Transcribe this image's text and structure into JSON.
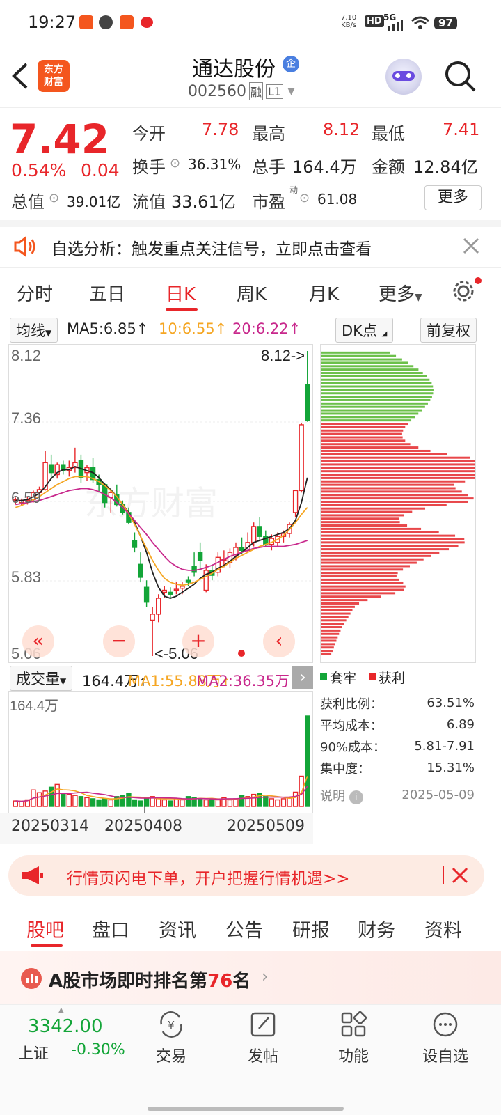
{
  "status_bar": {
    "time": "19:27",
    "net_speed": "7.10",
    "net_unit": "KB/s",
    "hd": "HD",
    "signal": "5G",
    "battery": "97"
  },
  "header": {
    "logo_line1": "东方",
    "logo_line2": "财富",
    "stock_name": "通达股份",
    "badge": "企",
    "code": "002560",
    "tag1": "融",
    "tag2": "L1"
  },
  "quote": {
    "price": "7.42",
    "change_pct": "0.54%",
    "change": "0.04",
    "open_label": "今开",
    "open": "7.78",
    "high_label": "最高",
    "high": "8.12",
    "low_label": "最低",
    "low": "7.41",
    "turnover_label": "换手",
    "turnover": "36.31%",
    "volume_label": "总手",
    "volume": "164.4万",
    "amount_label": "金额",
    "amount": "12.84亿",
    "mcap_label": "总值",
    "mcap": "39.01亿",
    "float_label": "流值",
    "float": "33.61亿",
    "pe_label": "市盈",
    "pe_sup": "动",
    "pe": "61.08",
    "more_btn": "更多"
  },
  "banner": {
    "text": "自选分析：触发重点关注信号，立即点击查看"
  },
  "kline_tabs": [
    "分时",
    "五日",
    "日K",
    "周K",
    "月K",
    "更多"
  ],
  "ma_bar": {
    "select": "均线",
    "ma5": "MA5:6.85",
    "ma10": "10:6.55",
    "ma20": "20:6.22",
    "dk": "DK点",
    "adjust": "前复权"
  },
  "chart_labels": {
    "y_top": "8.12",
    "y_2": "7.36",
    "y_3": "6.59",
    "y_4": "5.83",
    "y_bottom": "5.06",
    "max_marker": "8.12->",
    "min_marker": "<-5.06",
    "watermark": "东方财富"
  },
  "volume_bar": {
    "select": "成交量",
    "vol": "164.4万",
    "ma1": "MA1:55.88万",
    "ma2": "MA2:36.35万",
    "vol_top": "164.4万"
  },
  "dates": [
    "20250314",
    "20250408",
    "20250509"
  ],
  "chip": {
    "legend_hold": "套牢",
    "legend_profit": "获利",
    "rows": [
      {
        "label": "获利比例：",
        "value": "63.51%"
      },
      {
        "label": "平均成本：",
        "value": "6.89"
      },
      {
        "label": "90%成本：",
        "value": "5.81-7.91"
      },
      {
        "label": "集中度：",
        "value": "15.31%"
      }
    ],
    "note": "说明",
    "date": "2025-05-09"
  },
  "promo": {
    "text": "行情页闪电下单，开户把握行情机遇>>"
  },
  "bottom_tabs": [
    "股吧",
    "盘口",
    "资讯",
    "公告",
    "研报",
    "财务",
    "资料"
  ],
  "rank": {
    "prefix": "A股市场即时排名第",
    "num": "76",
    "suffix": "名"
  },
  "index": {
    "value": "3342.00",
    "name": "上证",
    "change": "-0.30%"
  },
  "bottom_nav": [
    "交易",
    "发帖",
    "功能",
    "设自选"
  ],
  "colors": {
    "up": "#e8262a",
    "down": "#13a538",
    "ma5": "#222222",
    "ma10": "#f5a623",
    "ma20": "#c8288c"
  },
  "chart_data": {
    "type": "candlestick",
    "ylim": [
      5.06,
      8.12
    ],
    "candles": [
      [
        6.62,
        6.65,
        6.58,
        6.63
      ],
      [
        6.6,
        6.64,
        6.57,
        6.62
      ],
      [
        6.62,
        6.66,
        6.58,
        6.63
      ],
      [
        6.63,
        6.72,
        6.6,
        6.7
      ],
      [
        6.7,
        6.76,
        6.66,
        6.73
      ],
      [
        6.73,
        7.12,
        6.72,
        7.0
      ],
      [
        6.98,
        7.08,
        6.85,
        6.9
      ],
      [
        6.88,
        7.0,
        6.84,
        6.98
      ],
      [
        6.98,
        7.02,
        6.88,
        6.92
      ],
      [
        6.92,
        7.02,
        6.86,
        6.95
      ],
      [
        6.95,
        7.15,
        6.9,
        7.0
      ],
      [
        7.02,
        7.08,
        6.8,
        6.85
      ],
      [
        6.9,
        6.98,
        6.82,
        6.95
      ],
      [
        6.95,
        7.05,
        6.8,
        6.83
      ],
      [
        6.83,
        6.88,
        6.7,
        6.78
      ],
      [
        6.78,
        6.8,
        6.55,
        6.6
      ],
      [
        6.65,
        6.72,
        6.5,
        6.7
      ],
      [
        6.68,
        6.78,
        6.56,
        6.58
      ],
      [
        6.58,
        6.62,
        6.48,
        6.5
      ],
      [
        6.5,
        6.55,
        6.38,
        6.4
      ],
      [
        6.22,
        6.3,
        6.1,
        6.15
      ],
      [
        5.98,
        6.1,
        5.8,
        5.85
      ],
      [
        5.75,
        5.82,
        5.55,
        5.6
      ],
      [
        5.42,
        5.55,
        5.06,
        5.48
      ],
      [
        5.48,
        5.68,
        5.4,
        5.64
      ],
      [
        5.7,
        5.76,
        5.64,
        5.72
      ],
      [
        5.7,
        5.75,
        5.64,
        5.68
      ],
      [
        5.72,
        5.8,
        5.68,
        5.73
      ],
      [
        5.74,
        5.8,
        5.68,
        5.76
      ],
      [
        5.82,
        5.86,
        5.76,
        5.8
      ],
      [
        5.96,
        6.1,
        5.86,
        5.9
      ],
      [
        6.1,
        6.2,
        5.92,
        6.02
      ],
      [
        5.72,
        5.98,
        5.7,
        5.92
      ],
      [
        5.92,
        5.98,
        5.82,
        5.87
      ],
      [
        5.9,
        6.1,
        5.86,
        6.05
      ],
      [
        6.02,
        6.12,
        5.95,
        6.03
      ],
      [
        6.0,
        6.14,
        5.94,
        6.1
      ],
      [
        6.08,
        6.2,
        6.02,
        6.15
      ],
      [
        6.15,
        6.25,
        6.08,
        6.12
      ],
      [
        6.12,
        6.3,
        6.1,
        6.2
      ],
      [
        6.2,
        6.4,
        6.16,
        6.36
      ],
      [
        6.36,
        6.45,
        6.22,
        6.26
      ],
      [
        6.26,
        6.32,
        6.15,
        6.18
      ],
      [
        6.18,
        6.28,
        6.12,
        6.24
      ],
      [
        6.2,
        6.3,
        6.15,
        6.26
      ],
      [
        6.26,
        6.32,
        6.2,
        6.29
      ],
      [
        6.29,
        6.4,
        6.25,
        6.38
      ],
      [
        6.5,
        6.7,
        6.45,
        6.72
      ],
      [
        6.72,
        7.4,
        6.7,
        7.38
      ],
      [
        7.78,
        8.12,
        7.41,
        7.42
      ]
    ],
    "ma5": [
      6.62,
      6.62,
      6.63,
      6.66,
      6.69,
      6.76,
      6.84,
      6.9,
      6.93,
      6.93,
      6.96,
      6.94,
      6.92,
      6.9,
      6.85,
      6.78,
      6.73,
      6.66,
      6.58,
      6.5,
      6.4,
      6.26,
      6.1,
      5.9,
      5.75,
      5.66,
      5.64,
      5.66,
      5.7,
      5.74,
      5.78,
      5.84,
      5.88,
      5.9,
      5.94,
      5.97,
      6.01,
      6.06,
      6.1,
      6.15,
      6.2,
      6.22,
      6.24,
      6.26,
      6.28,
      6.3,
      6.34,
      6.42,
      6.6,
      6.85
    ],
    "ma10": [
      6.55,
      6.57,
      6.6,
      6.63,
      6.66,
      6.7,
      6.74,
      6.78,
      6.81,
      6.84,
      6.86,
      6.86,
      6.86,
      6.84,
      6.81,
      6.77,
      6.72,
      6.66,
      6.58,
      6.49,
      6.38,
      6.26,
      6.14,
      6.02,
      5.92,
      5.84,
      5.8,
      5.78,
      5.77,
      5.78,
      5.8,
      5.83,
      5.86,
      5.89,
      5.93,
      5.96,
      6.0,
      6.04,
      6.07,
      6.1,
      6.13,
      6.16,
      6.18,
      6.2,
      6.23,
      6.27,
      6.33,
      6.4,
      6.48,
      6.55
    ],
    "ma20": [
      6.58,
      6.59,
      6.6,
      6.61,
      6.62,
      6.64,
      6.66,
      6.68,
      6.7,
      6.72,
      6.73,
      6.74,
      6.74,
      6.73,
      6.71,
      6.68,
      6.65,
      6.6,
      6.55,
      6.49,
      6.42,
      6.35,
      6.28,
      6.2,
      6.13,
      6.06,
      6.0,
      5.96,
      5.93,
      5.92,
      5.92,
      5.93,
      5.95,
      5.97,
      6.0,
      6.03,
      6.06,
      6.08,
      6.1,
      6.12,
      6.14,
      6.15,
      6.16,
      6.16,
      6.16,
      6.16,
      6.17,
      6.18,
      6.2,
      6.22
    ],
    "volume": [
      10,
      9,
      12,
      30,
      25,
      28,
      35,
      40,
      24,
      22,
      20,
      18,
      16,
      14,
      12,
      14,
      12,
      18,
      20,
      24,
      12,
      10,
      14,
      18,
      16,
      12,
      10,
      14,
      12,
      18,
      16,
      14,
      12,
      14,
      12,
      16,
      12,
      14,
      20,
      18,
      22,
      24,
      18,
      14,
      12,
      14,
      16,
      26,
      55,
      164.4
    ],
    "vol_ylim": [
      0,
      164.4
    ]
  }
}
